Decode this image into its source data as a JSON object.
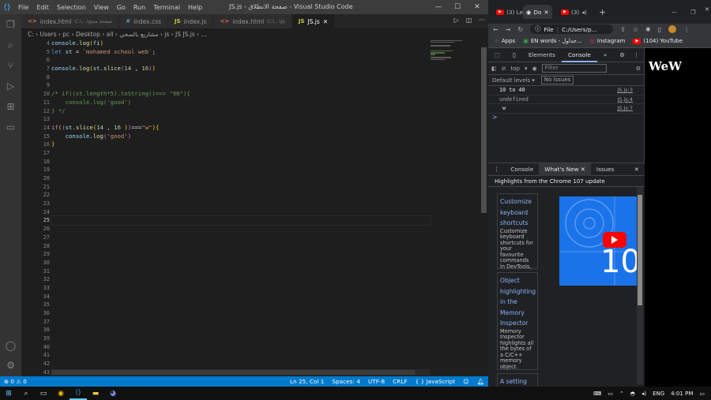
{
  "vscode": {
    "menu": [
      "File",
      "Edit",
      "Selection",
      "View",
      "Go",
      "Run",
      "Terminal",
      "Help"
    ],
    "window_title": "JS.js - صفحة الانطلاق - Visual Studio Code",
    "tabs": [
      {
        "icon": "<>",
        "label": "index.html",
        "desc": "C:\\...\\صفحة منتج",
        "active": false
      },
      {
        "icon": "#",
        "label": "index.css",
        "desc": "",
        "active": false
      },
      {
        "icon": "JS",
        "label": "index.js",
        "desc": "",
        "active": false
      },
      {
        "icon": "<>",
        "label": "index.html",
        "desc": "C:\\...\\js",
        "active": false
      },
      {
        "icon": "JS",
        "label": "JS.js",
        "desc": "",
        "active": true
      }
    ],
    "breadcrumb": "C: › Users › pc › Desktop › all › مشاريع بالصحي › js › JS JS.js › ...",
    "line_numbers": [
      "4",
      "5",
      "6",
      "7",
      "8",
      "9",
      "10",
      "11",
      "12",
      "13",
      "14",
      "15",
      "16",
      "17",
      "18",
      "19",
      "20",
      "21",
      "22",
      "23",
      "24",
      "25",
      "26",
      "27",
      "28",
      "29",
      "30",
      "31",
      "32",
      "33",
      "34",
      "35",
      "36",
      "37",
      "38",
      "39",
      "40",
      "41",
      "42",
      "43"
    ],
    "current_line": "25",
    "statusbar": {
      "errors": "⊗ 0  ⚠ 0",
      "position": "Ln 25, Col 1",
      "spaces": "Spaces: 4",
      "encoding": "UTF-8",
      "eol": "CRLF",
      "language": "{ } JavaScript"
    }
  },
  "chrome": {
    "tabs": [
      {
        "label": "(3) Le"
      },
      {
        "label": "Do"
      },
      {
        "label": "(3)"
      }
    ],
    "address": "C:/Users/p...",
    "address_prefix": "File",
    "bookmarks": [
      "Apps",
      "EN words - جداول...",
      "Instagram",
      "(104) YouTube"
    ],
    "devtools": {
      "tabs": [
        "Elements",
        "Console"
      ],
      "context": "top",
      "filter_placeholder": "Filter",
      "levels": "Default levels ▾",
      "issues": "No Issues",
      "console": [
        {
          "text": "10 to 40",
          "link": "JS.js:3"
        },
        {
          "text": "undefined",
          "link": "JS.js:4"
        },
        {
          "text": "w",
          "link": "JS.js:7"
        }
      ],
      "prompt": ">",
      "drawer_tabs": [
        "Console",
        "What's New",
        "Issues"
      ],
      "whats_new_title": "Highlights from the Chrome 107 update",
      "cards": [
        {
          "title": "Customize keyboard shortcuts",
          "desc": "Customize keyboard shortcuts for your favourite commands in DevTools."
        },
        {
          "title": "Object highlighting in the Memory Inspector",
          "desc": "Memory Inspector highlights all the bytes of a C/C++ memory object."
        },
        {
          "title": "A setting"
        }
      ],
      "video_text": "10"
    },
    "page_text": "WeW"
  },
  "taskbar": {
    "language": "ENG",
    "time": "4:01 PM"
  }
}
